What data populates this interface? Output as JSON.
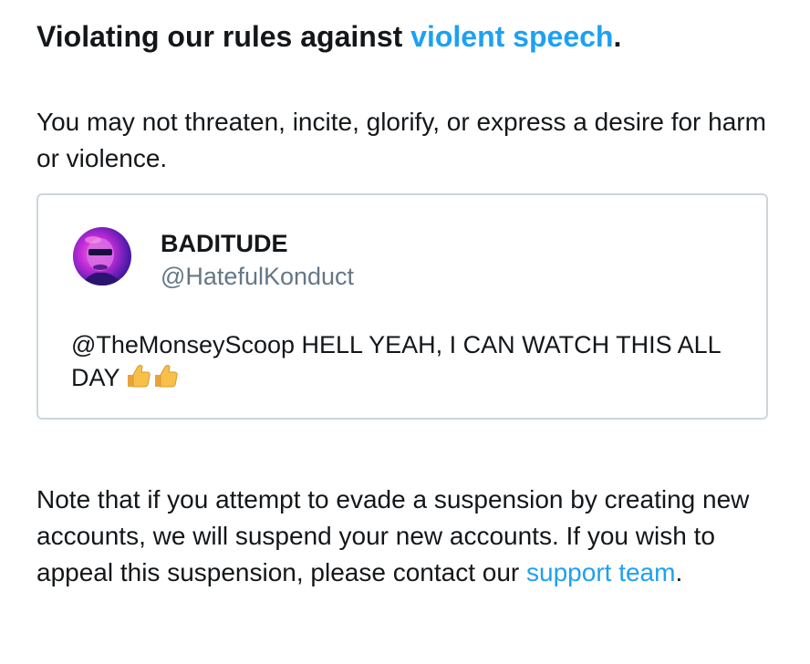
{
  "heading": {
    "prefix": "Violating our rules against ",
    "link": "violent speech",
    "suffix": "."
  },
  "rule_text": "You may not threaten, incite, glorify, or express a desire for harm or violence.",
  "tweet": {
    "display_name": "BADITUDE",
    "handle": "@HatefulKonduct",
    "text": "@TheMonseyScoop HELL YEAH, I CAN WATCH THIS ALL DAY",
    "emoji": "thumbs-up-icon x2"
  },
  "note": {
    "prefix": "Note that if you attempt to evade a suspension by creating new accounts, we will suspend your new accounts. If you wish to appeal this suspension, please contact our ",
    "link": "support team",
    "suffix": "."
  },
  "colors": {
    "link": "#1da1f2",
    "text": "#14171a",
    "secondary": "#657786",
    "border": "#ccd6dd"
  }
}
